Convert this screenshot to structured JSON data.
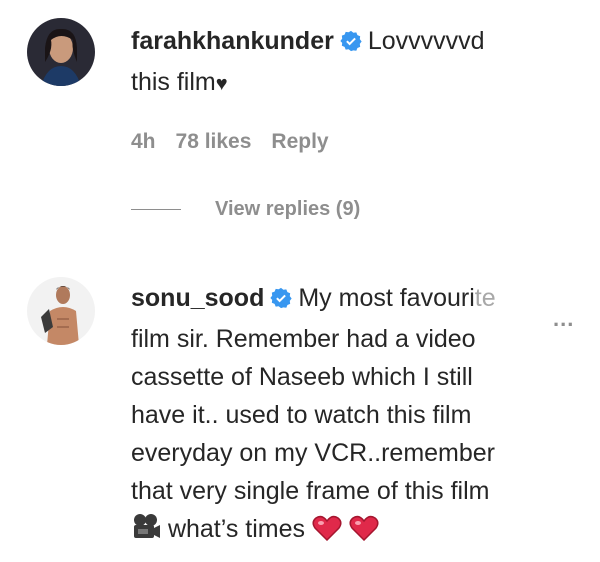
{
  "comments": [
    {
      "username": "farahkhankunder",
      "text_line1": "Lovvvvvvd",
      "text_line2": "this film",
      "heart_glyph": "♥",
      "time": "4h",
      "likes": "78 likes",
      "reply_label": "Reply",
      "view_replies": "View replies (9)"
    },
    {
      "username": "sonu_sood",
      "text_line1_main": "My most favouri",
      "text_line1_fade": "te",
      "more_glyph": "...",
      "lines": [
        "film sir. Remember had a video",
        "cassette of Naseeb which I still",
        "have it.. used to watch this film",
        "everyday on my VCR..remember",
        "that very single frame of this film"
      ],
      "last_line_text": " what’s times "
    }
  ],
  "colors": {
    "verified": "#3897f0",
    "meta": "#8e8e8e",
    "heart": "#ed4956"
  },
  "icons": [
    "verified-badge-icon",
    "heart-icon",
    "camera-icon",
    "more-options-icon"
  ]
}
